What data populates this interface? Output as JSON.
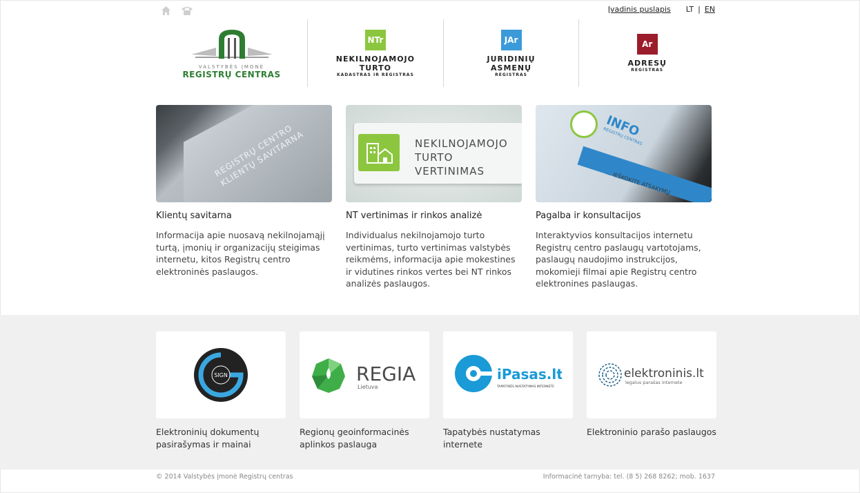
{
  "header": {
    "icons": [
      "home-icon",
      "phone-icon"
    ],
    "intro_link": "Įvadinis puslapis",
    "lang_lt": "LT",
    "lang_sep": "|",
    "lang_en": "EN"
  },
  "logos": {
    "rc": {
      "line1": "VALSTYBĖS ĮMONĖ",
      "line2": "REGISTRŲ CENTRAS"
    },
    "nt": {
      "mark": "NTr",
      "title1": "NEKILNOJAMOJO",
      "title2": "TURTO",
      "sub": "KADASTRAS IR REGISTRAS",
      "color": "#8cc63f"
    },
    "ja": {
      "mark": "JAr",
      "title1": "JURIDINIŲ",
      "title2": "ASMENŲ",
      "sub": "REGISTRAS",
      "color": "#3b9ad9"
    },
    "ar": {
      "mark": "Ar",
      "title1": "ADRESŲ",
      "sub": "REGISTRAS",
      "color": "#9b1c2a"
    }
  },
  "cards": [
    {
      "image_text1": "REGISTRŲ CENTRO",
      "image_text2": "KLIENTŲ SAVITARNA",
      "title": "Klientų savitarna",
      "desc": "Informacija apie nuosavą nekilnojamąjį turtą, įmonių ir organizacijų steigimas internetu, kitos Registrų centro elektroninės paslaugos."
    },
    {
      "image_text1": "NEKILNOJAMOJO",
      "image_text2": "TURTO",
      "image_text3": "VERTINIMAS",
      "title": "NT vertinimas ir rinkos analizė",
      "desc": "Individualus nekilnojamojo turto vertinimas, turto vertinimas valstybės reikmėms, informacija apie mokestines ir vidutines rinkos vertes bei NT rinkos analizės paslaugos."
    },
    {
      "image_text1": "INFO",
      "image_text2": "REGISTRŲ CENTRAS",
      "image_text3": "... IEŠKOKITE ATSAKYMŲ",
      "title": "Pagalba ir konsultacijos",
      "desc": "Interaktyvios konsultacijos internetu Registrų centro paslaugų vartotojams, paslaugų naudojimo instrukcijos, mokomieji filmai apie Registrų centro elektronines paslaugas."
    }
  ],
  "partners": [
    {
      "logo_text": "SIGN",
      "label": "Elektroninių dokumentų pasirašymas ir mainai"
    },
    {
      "logo_text": "REGIA",
      "logo_sub": "Lietuva",
      "label": "Regionų geoinformacinės aplinkos paslauga"
    },
    {
      "logo_text": "iPasas.lt",
      "logo_sub": "TAPATYBĖS NUSTATYMAS INTERNETE",
      "label": "Tapatybės nustatymas internete"
    },
    {
      "logo_text": "elektroninis.lt",
      "logo_sub": "legalus parašas internete",
      "label": "Elektroninio parašo paslaugos"
    }
  ],
  "footer": {
    "copyright": "© 2014 Valstybės įmonė Registrų centras",
    "contact": "Informacinė tarnyba: tel. (8 5) 268 8262; mob. 1637"
  }
}
